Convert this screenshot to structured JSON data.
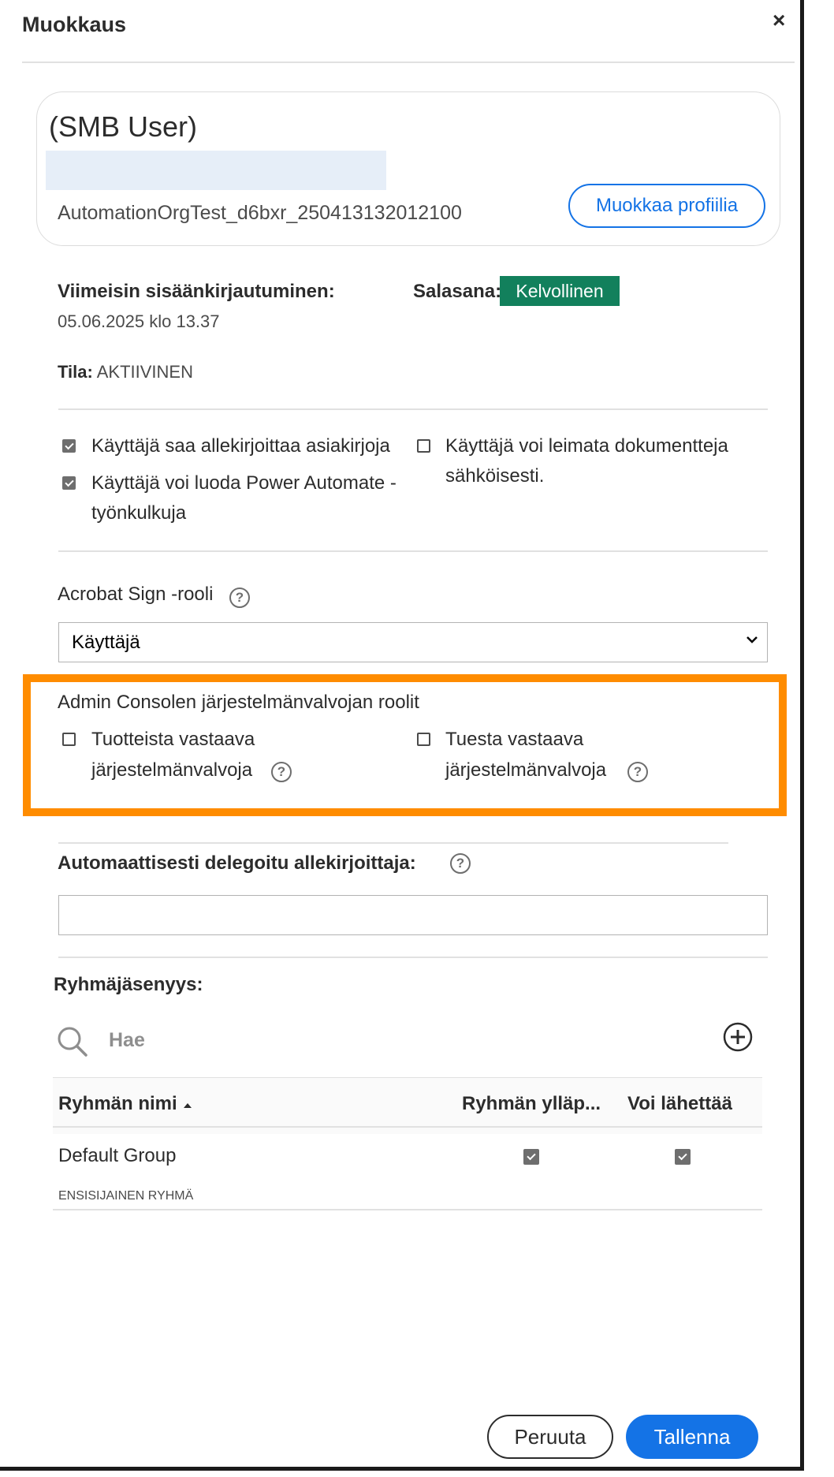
{
  "dialog": {
    "title": "Muokkaus",
    "close_symbol": "×"
  },
  "profile": {
    "name": "(SMB User)",
    "org": "AutomationOrgTest_d6bxr_250413132012100",
    "edit_profile_label": "Muokkaa profiilia"
  },
  "info": {
    "last_login_label": "Viimeisin sisäänkirjautuminen:",
    "last_login_value": "05.06.2025 klo 13.37",
    "password_label": "Salasana:",
    "password_status": "Kelvollinen",
    "status_label": "Tila:",
    "status_value": "AKTIIVINEN"
  },
  "permissions": [
    {
      "label": "Käyttäjä saa allekirjoittaa asiakirjoja",
      "checked": true
    },
    {
      "label": "Käyttäjä voi luoda Power Automate -",
      "label2": "työnkulkuja",
      "checked": true
    },
    {
      "label": "Käyttäjä voi leimata dokumentteja",
      "label2": "sähköisesti.",
      "checked": false
    }
  ],
  "sign_role": {
    "label": "Acrobat Sign -rooli",
    "selected": "Käyttäjä"
  },
  "admin_roles": {
    "heading": "Admin Consolen järjestelmänvalvojan roolit",
    "items": [
      {
        "line1": "Tuotteista vastaava",
        "line2": "järjestelmänvalvoja",
        "checked": false
      },
      {
        "line1": "Tuesta vastaava",
        "line2": "järjestelmänvalvoja",
        "checked": false
      }
    ]
  },
  "delegate": {
    "label": "Automaattisesti delegoitu allekirjoittaja:",
    "value": ""
  },
  "groups": {
    "heading": "Ryhmäjäsenyys:",
    "search_placeholder": "Hae",
    "columns": [
      "Ryhmän nimi",
      "Ryhmän ylläp...",
      "Voi lähettää"
    ],
    "rows": [
      {
        "name": "Default Group",
        "sub": "ENSISIJAINEN RYHMÄ",
        "admin": true,
        "can_send": true
      }
    ]
  },
  "footer": {
    "cancel_label": "Peruuta",
    "save_label": "Tallenna"
  },
  "colors": {
    "accent": "#1473e6",
    "valid_badge": "#12805c",
    "highlight": "#ff8c00"
  }
}
